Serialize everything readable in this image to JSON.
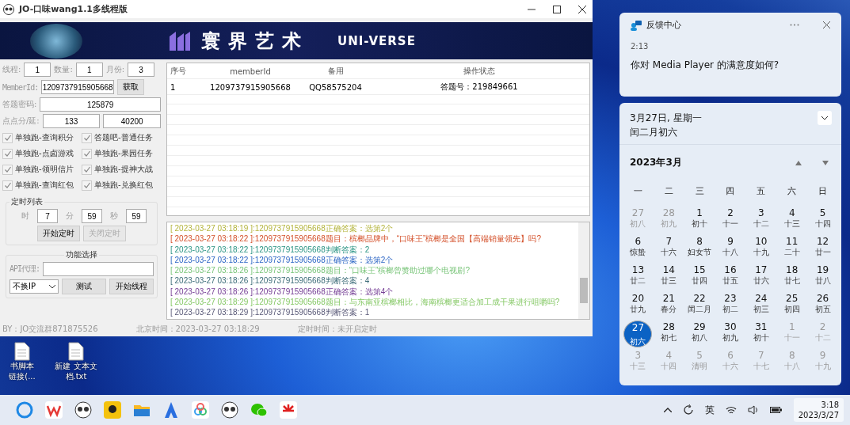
{
  "window": {
    "title": "JO-口味wang1.1多线程版"
  },
  "banner": {
    "title": "寰界艺术",
    "subtitle": "UNI-VERSE"
  },
  "form": {
    "counts": [
      {
        "label": "线程:",
        "value": "1"
      },
      {
        "label": "数量:",
        "value": "1"
      },
      {
        "label": "月份:",
        "value": "3"
      }
    ],
    "member": {
      "label": "MemberId:",
      "value": "1209737915905668",
      "button": "获取"
    },
    "password": {
      "label": "答题密码:",
      "value": "125879"
    },
    "points": {
      "label": "点点分/延:",
      "values": [
        "133",
        "40200"
      ]
    },
    "checkboxes": [
      {
        "label": "单独跑-查询积分",
        "checked": true
      },
      {
        "label": "答题吧-普通任务",
        "checked": true
      },
      {
        "label": "单独跑-点卤游戏",
        "checked": true
      },
      {
        "label": "单独跑-果园任务",
        "checked": true
      },
      {
        "label": "单独跑-领明信片",
        "checked": true
      },
      {
        "label": "单独跑-提神大战",
        "checked": true
      },
      {
        "label": "单独跑-查询红包",
        "checked": true
      },
      {
        "label": "单独跑-兑换红包",
        "checked": true
      }
    ]
  },
  "timer": {
    "title": "定时列表",
    "fields": [
      {
        "label": "时",
        "value": "7"
      },
      {
        "label": "分",
        "value": "59"
      },
      {
        "label": "秒",
        "value": "59"
      }
    ],
    "buttons": [
      {
        "label": "开始定时",
        "disabled": false
      },
      {
        "label": "关闭定时",
        "disabled": true
      }
    ]
  },
  "functions": {
    "title": "功能选择",
    "proxy_label": "API代理:",
    "select": "不换IP",
    "buttons": [
      "测试",
      "开始线程"
    ]
  },
  "table": {
    "columns": [
      "序号",
      "memberId",
      "备用",
      "操作状态"
    ],
    "rows": [
      [
        "1",
        "1209737915905668",
        "QQ58575204",
        "答题号：219849661"
      ]
    ]
  },
  "log": [
    {
      "text": "[ 2023-03-27 03:18:19 ]:1209737915905668正确答案：选第2个",
      "color": "#b4b43c"
    },
    {
      "text": "[ 2023-03-27 03:18:22 ]:1209737915905668题目：槟榔品牌中，“口味王”槟榔是全国【高端销量领先】吗?",
      "color": "#d4502a"
    },
    {
      "text": "[ 2023-03-27 03:18:22 ]:1209737915905668判断答案：2",
      "color": "#2a9484"
    },
    {
      "text": "[ 2023-03-27 03:18:22 ]:1209737915905668正确答案：选第2个",
      "color": "#2a64c4"
    },
    {
      "text": "[ 2023-03-27 03:18:26 ]:1209737915905668题目：“口味王”槟榔曾赞助过哪个电视剧?",
      "color": "#78c478"
    },
    {
      "text": "[ 2023-03-27 03:18:26 ]:1209737915905668判断答案：4",
      "color": "#3c6c78"
    },
    {
      "text": "[ 2023-03-27 03:18:26 ]:1209737915905668正确答案：选第4个",
      "color": "#743c94"
    },
    {
      "text": "[ 2023-03-27 03:18:29 ]:1209737915905668题目：与东南亚槟榔相比，海南槟榔更适合加工成干果进行咀嚼吗?",
      "color": "#84c864"
    },
    {
      "text": "[ 2023-03-27 03:18:29 ]:1209737915905668判断答案：1",
      "color": "#5a5a78"
    }
  ],
  "status_bar": [
    "BY：JO交流群871875526",
    "北京时间：2023-03-27 03:18:29",
    "定时时间：未开启定时"
  ],
  "desktop_icons": [
    {
      "lines": [
        "书脚本",
        "链接(..."
      ]
    },
    {
      "lines": [
        "新建 文本文",
        "档.txt"
      ]
    }
  ],
  "notification": {
    "app": "反馈中心",
    "time": "2:13",
    "message": "你对 Media Player 的满意度如何?"
  },
  "calendar": {
    "date": "3月27日, 星期一",
    "lunar_date": "闰二月初六",
    "month": "2023年3月",
    "weekdays": [
      "一",
      "二",
      "三",
      "四",
      "五",
      "六",
      "日"
    ],
    "weeks": [
      [
        {
          "d": "27",
          "l": "初八",
          "muted": true,
          "selected": false
        },
        {
          "d": "28",
          "l": "初九",
          "muted": true,
          "selected": false
        },
        {
          "d": "1",
          "l": "初十",
          "muted": false,
          "selected": false
        },
        {
          "d": "2",
          "l": "十一",
          "muted": false,
          "selected": false
        },
        {
          "d": "3",
          "l": "十二",
          "muted": false,
          "selected": false
        },
        {
          "d": "4",
          "l": "十三",
          "muted": false,
          "selected": false
        },
        {
          "d": "5",
          "l": "十四",
          "muted": false,
          "selected": false
        }
      ],
      [
        {
          "d": "6",
          "l": "惊蛰",
          "muted": false,
          "selected": false
        },
        {
          "d": "7",
          "l": "十六",
          "muted": false,
          "selected": false
        },
        {
          "d": "8",
          "l": "妇女节",
          "muted": false,
          "selected": false
        },
        {
          "d": "9",
          "l": "十八",
          "muted": false,
          "selected": false
        },
        {
          "d": "10",
          "l": "十九",
          "muted": false,
          "selected": false
        },
        {
          "d": "11",
          "l": "二十",
          "muted": false,
          "selected": false
        },
        {
          "d": "12",
          "l": "廿一",
          "muted": false,
          "selected": false
        }
      ],
      [
        {
          "d": "13",
          "l": "廿二",
          "muted": false,
          "selected": false
        },
        {
          "d": "14",
          "l": "廿三",
          "muted": false,
          "selected": false
        },
        {
          "d": "15",
          "l": "廿四",
          "muted": false,
          "selected": false
        },
        {
          "d": "16",
          "l": "廿五",
          "muted": false,
          "selected": false
        },
        {
          "d": "17",
          "l": "廿六",
          "muted": false,
          "selected": false
        },
        {
          "d": "18",
          "l": "廿七",
          "muted": false,
          "selected": false
        },
        {
          "d": "19",
          "l": "廿八",
          "muted": false,
          "selected": false
        }
      ],
      [
        {
          "d": "20",
          "l": "廿九",
          "muted": false,
          "selected": false
        },
        {
          "d": "21",
          "l": "春分",
          "muted": false,
          "selected": false
        },
        {
          "d": "22",
          "l": "闰二月",
          "muted": false,
          "selected": false
        },
        {
          "d": "23",
          "l": "初二",
          "muted": false,
          "selected": false
        },
        {
          "d": "24",
          "l": "初三",
          "muted": false,
          "selected": false
        },
        {
          "d": "25",
          "l": "初四",
          "muted": false,
          "selected": false
        },
        {
          "d": "26",
          "l": "初五",
          "muted": false,
          "selected": false
        }
      ],
      [
        {
          "d": "27",
          "l": "初六",
          "muted": false,
          "selected": true
        },
        {
          "d": "28",
          "l": "初七",
          "muted": false,
          "selected": false
        },
        {
          "d": "29",
          "l": "初八",
          "muted": false,
          "selected": false
        },
        {
          "d": "30",
          "l": "初九",
          "muted": false,
          "selected": false
        },
        {
          "d": "31",
          "l": "初十",
          "muted": false,
          "selected": false
        },
        {
          "d": "1",
          "l": "十一",
          "muted": true,
          "selected": false
        },
        {
          "d": "2",
          "l": "十二",
          "muted": true,
          "selected": false
        }
      ],
      [
        {
          "d": "3",
          "l": "十三",
          "muted": true,
          "selected": false
        },
        {
          "d": "4",
          "l": "十四",
          "muted": true,
          "selected": false
        },
        {
          "d": "5",
          "l": "清明",
          "muted": true,
          "selected": false
        },
        {
          "d": "6",
          "l": "十六",
          "muted": true,
          "selected": false
        },
        {
          "d": "7",
          "l": "十七",
          "muted": true,
          "selected": false
        },
        {
          "d": "8",
          "l": "十八",
          "muted": true,
          "selected": false
        },
        {
          "d": "9",
          "l": "十九",
          "muted": true,
          "selected": false
        }
      ]
    ]
  },
  "tray": {
    "ime": "英",
    "time": "3:18",
    "date": "2023/3/27"
  }
}
